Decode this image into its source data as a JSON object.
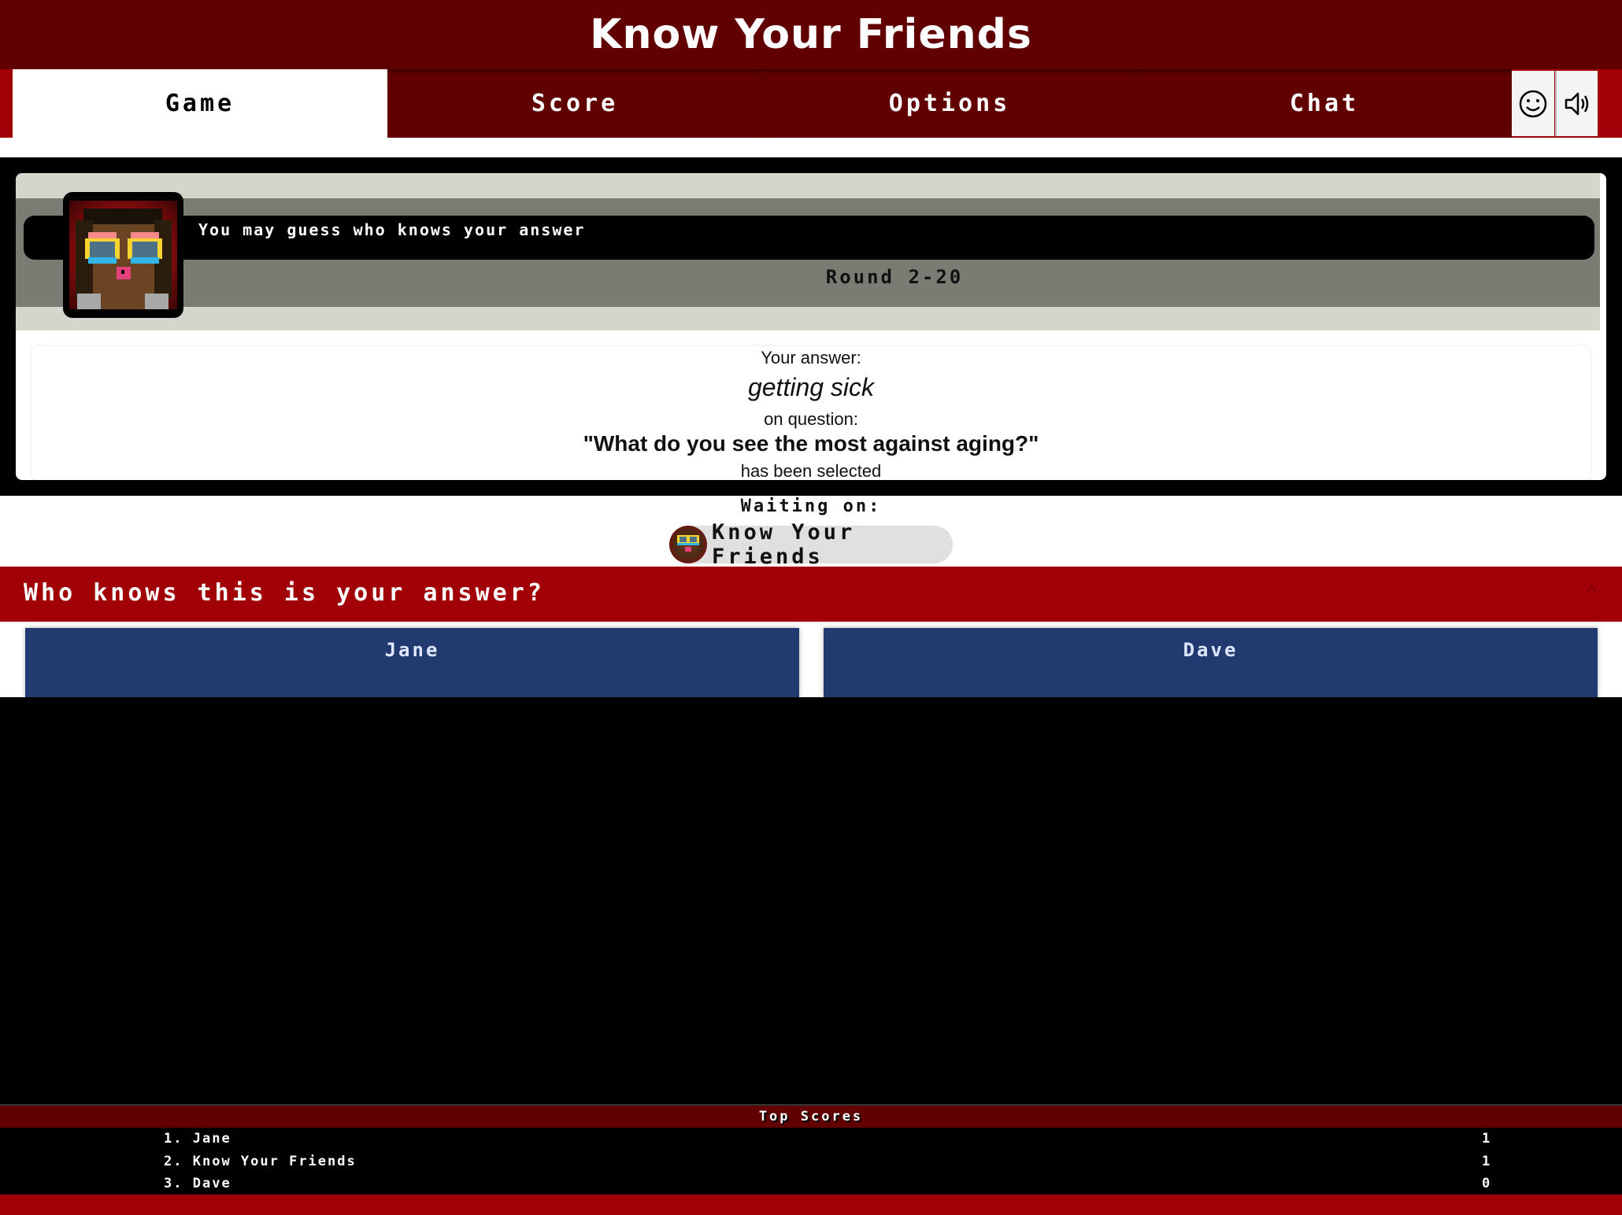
{
  "app": {
    "title": "Know Your Friends"
  },
  "tabs": [
    {
      "label": "Game",
      "active": true
    },
    {
      "label": "Score",
      "active": false
    },
    {
      "label": "Options",
      "active": false
    },
    {
      "label": "Chat",
      "active": false
    }
  ],
  "toolbar": {
    "emoji_icon": "smiley-icon",
    "sound_icon": "speaker-volume-icon"
  },
  "status": {
    "message": "You may guess who knows your answer",
    "round": "Round 2-20"
  },
  "answer": {
    "intro": "Your answer:",
    "text": "getting sick",
    "question_intro": "on question:",
    "question": "\"What do you see the most against aging?\"",
    "outro": "has been selected"
  },
  "waiting": {
    "label": "Waiting on:",
    "players": [
      "Know Your Friends"
    ]
  },
  "guess_section": {
    "title": "Who knows this is your answer?",
    "collapse_icon": "chevron-up-icon",
    "players": [
      "Jane",
      "Dave"
    ]
  },
  "top_scores": {
    "title": "Top Scores",
    "rows": [
      {
        "rank": "1.",
        "name": "Jane",
        "score": "1"
      },
      {
        "rank": "2.",
        "name": "Know Your Friends",
        "score": "1"
      },
      {
        "rank": "3.",
        "name": "Dave",
        "score": "0"
      }
    ]
  },
  "colors": {
    "header": "#600000",
    "accent_red": "#a00006",
    "player_card": "#213a6f",
    "banner_light": "#d6d5cd",
    "banner_mid": "#7b7a73"
  }
}
